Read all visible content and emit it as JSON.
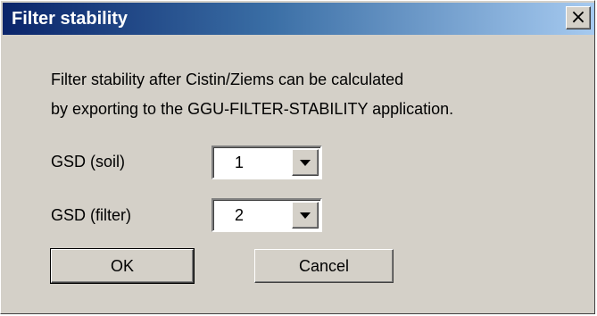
{
  "window": {
    "title": "Filter stability",
    "close_icon": "close-icon",
    "close_glyph": "×"
  },
  "message": {
    "line1": "Filter stability after Cistin/Ziems can be calculated",
    "line2": "by exporting to the GGU-FILTER-STABILITY application."
  },
  "fields": {
    "soil": {
      "label": "GSD (soil)",
      "value": "1"
    },
    "filter": {
      "label": "GSD (filter)",
      "value": "2"
    }
  },
  "buttons": {
    "ok": "OK",
    "cancel": "Cancel"
  },
  "colors": {
    "face": "#d4d0c8",
    "title_gradient_start": "#0a246a",
    "title_gradient_end": "#a6caf0"
  }
}
